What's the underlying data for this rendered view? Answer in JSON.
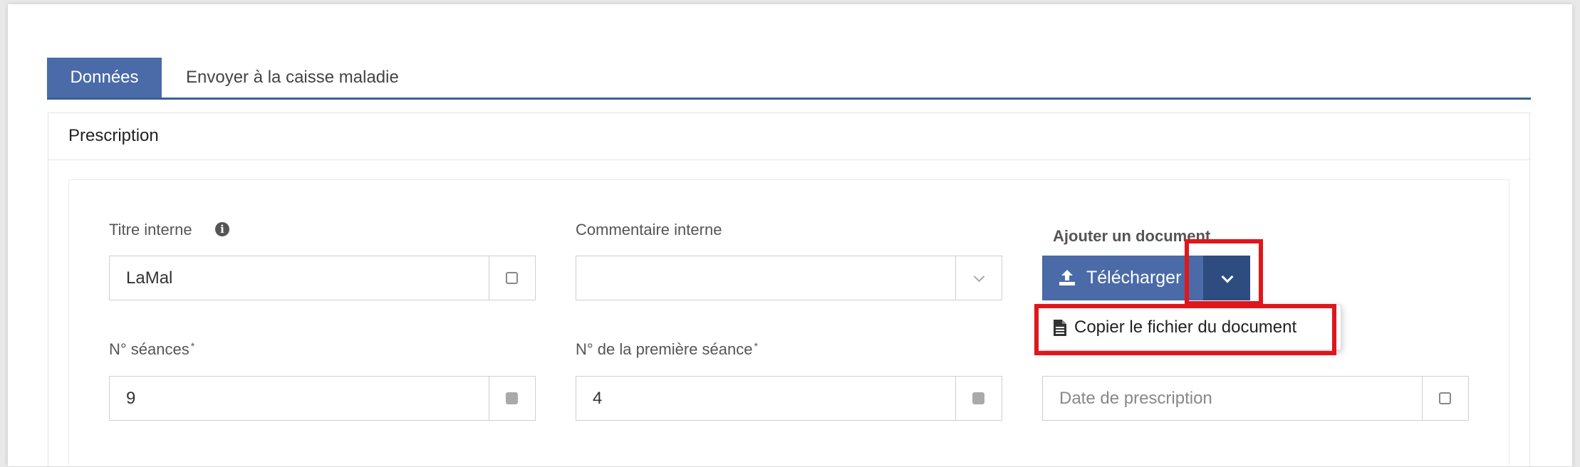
{
  "tabs": [
    {
      "label": "Données",
      "active": true
    },
    {
      "label": "Envoyer à la caisse maladie",
      "active": false
    }
  ],
  "panel": {
    "title": "Prescription"
  },
  "fields": {
    "titre_interne": {
      "label": "Titre interne",
      "value": "LaMal"
    },
    "commentaire_interne": {
      "label": "Commentaire interne",
      "value": ""
    },
    "ajouter_document": {
      "label": "Ajouter un document"
    },
    "seances": {
      "label": "N° séances",
      "required_mark": "*",
      "value": "9"
    },
    "premiere_seance": {
      "label": "N° de la première séance",
      "required_mark": "*",
      "value": "4"
    },
    "date_prescription": {
      "placeholder": "Date de prescription"
    }
  },
  "upload": {
    "button_label": "Télécharger"
  },
  "dropdown": {
    "items": [
      {
        "label": "Copier le fichier du document",
        "icon": "file-text-icon"
      }
    ]
  },
  "colors": {
    "primary": "#4a6ba8",
    "primary_dark": "#2f4c80",
    "highlight": "#e0161b"
  }
}
